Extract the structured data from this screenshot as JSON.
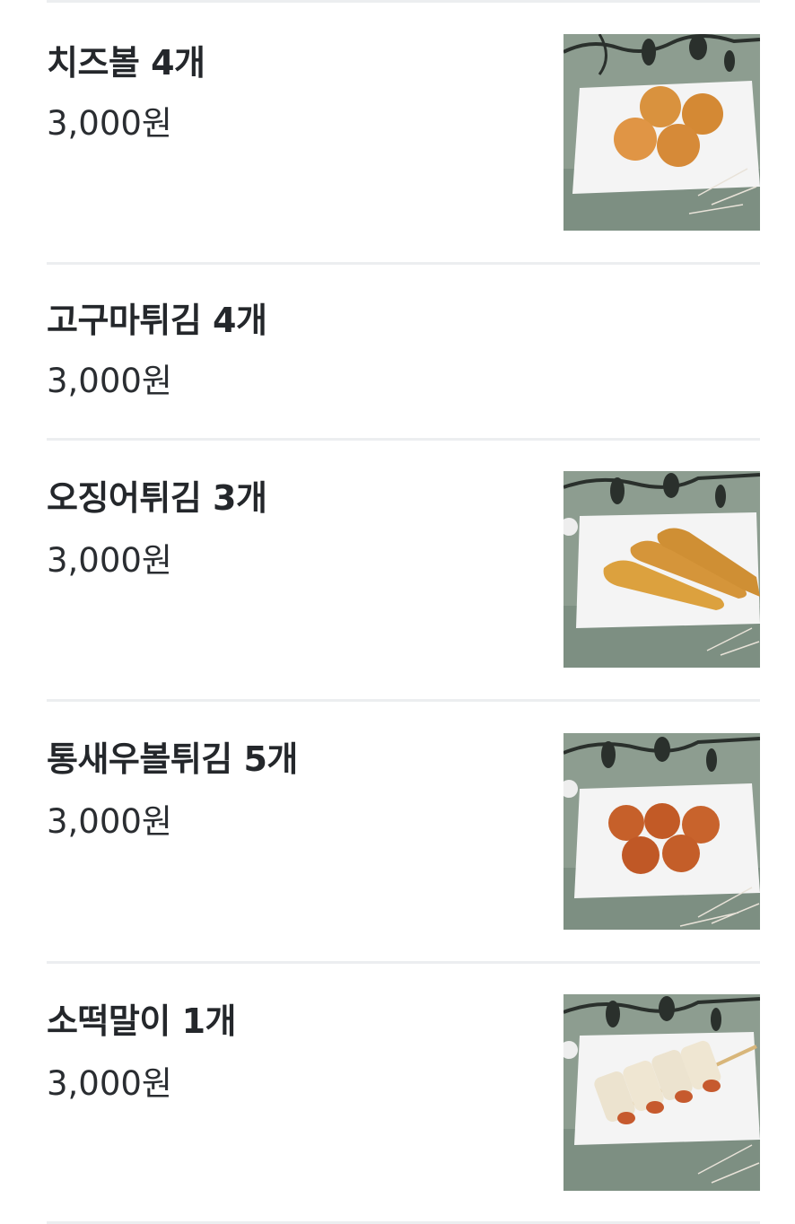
{
  "menu": {
    "items": [
      {
        "name": "치즈볼 4개",
        "price": "3,000원",
        "has_image": true,
        "image": "cheese-balls"
      },
      {
        "name": "고구마튀김 4개",
        "price": "3,000원",
        "has_image": false
      },
      {
        "name": "오징어튀김 3개",
        "price": "3,000원",
        "has_image": true,
        "image": "fried-squid"
      },
      {
        "name": "통새우볼튀김 5개",
        "price": "3,000원",
        "has_image": true,
        "image": "shrimp-balls"
      },
      {
        "name": "소떡말이 1개",
        "price": "3,000원",
        "has_image": true,
        "image": "sotteok-rolls"
      }
    ]
  }
}
